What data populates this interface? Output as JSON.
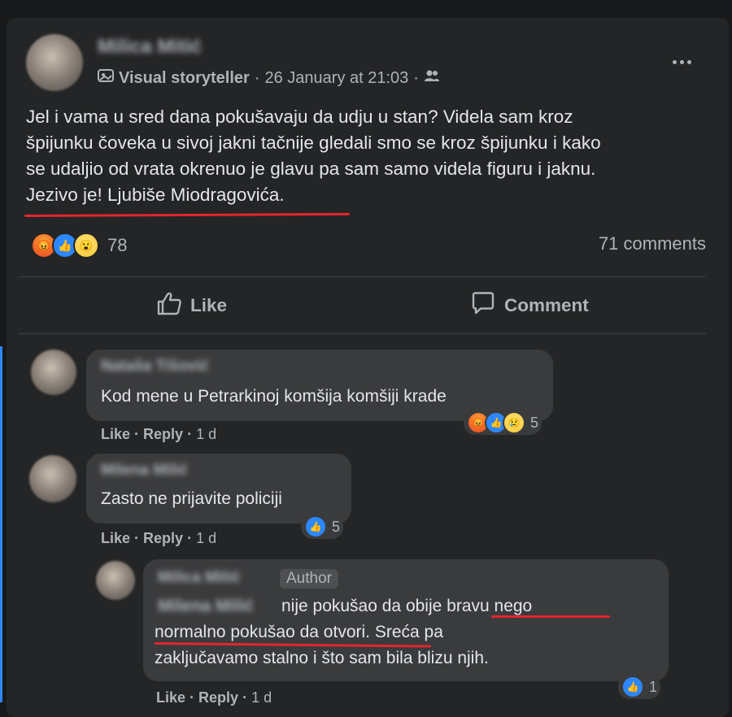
{
  "post": {
    "author_name": "Milica Mitić",
    "author_badge": "Visual storyteller",
    "date": "26 January at 21:03",
    "audience_icon": "friends-icon",
    "text_lines": [
      "Jel i vama u sred dana pokušavaju da udju u stan? Videla sam kroz",
      "špijunku čoveka u sivoj jakni tačnije gledali smo se kroz špijunku i kako",
      "se udaljio od vrata okrenuo je glavu pa sam samo videla figuru i jaknu.",
      "Jezivo je! Ljubiše Miodragovića."
    ],
    "reactions": [
      "angry",
      "like",
      "wow"
    ],
    "reaction_count": "78",
    "comments_count": "71 comments",
    "like_label": "Like",
    "comment_label": "Comment",
    "highlight_color": "#e3262e"
  },
  "comments": [
    {
      "author_name": "Nataša Tišović",
      "text": "Kod mene u Petrarkinoj komšija komšiji krade",
      "like_label": "Like",
      "reply_label": "Reply",
      "time": "1 d",
      "reactions": [
        "angry",
        "like",
        "sad"
      ],
      "reaction_count": "5"
    },
    {
      "author_name": "Milena Milić",
      "text": "Zasto ne prijavite policiji",
      "like_label": "Like",
      "reply_label": "Reply",
      "time": "1 d",
      "reactions": [
        "like"
      ],
      "reaction_count": "5"
    }
  ],
  "reply": {
    "author_name": "Milica Mitić",
    "author_label": "Author",
    "mention": "Milena Milić",
    "text_lines": [
      "nije pokušao da obije bravu nego",
      "normalno pokušao da otvori. Sreća pa",
      "zaključavamo stalno i što sam bila blizu njih."
    ],
    "like_label": "Like",
    "reply_label": "Reply",
    "time": "1 d",
    "reactions": [
      "like"
    ],
    "reaction_count": "1"
  }
}
